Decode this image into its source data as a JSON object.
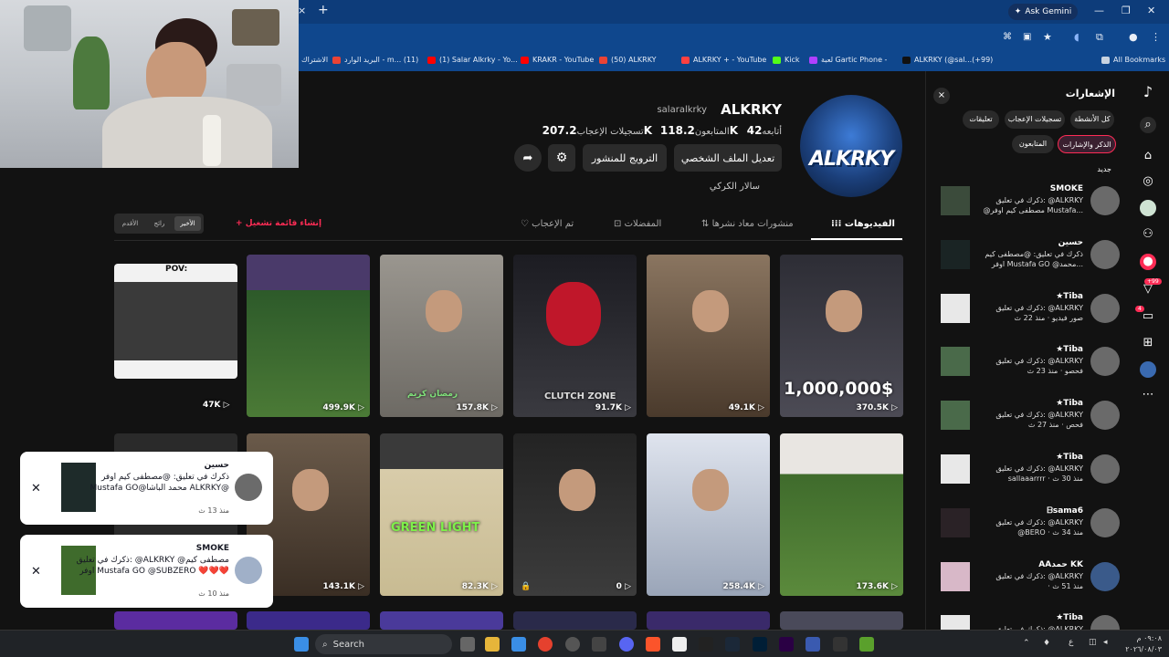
{
  "browser": {
    "gemini_label": "Ask Gemini",
    "new_tab": "+",
    "close_tab": "×",
    "bookmarks": [
      {
        "label": "الاشتراك",
        "color": "#cccccc"
      },
      {
        "label": "البريد الوارد - m... (11)",
        "color": "#ea4335"
      },
      {
        "label": "(1) Salar Alkrky - Yo...",
        "color": "#ff0000"
      },
      {
        "label": "KRAKR - YouTube",
        "color": "#ff0000"
      },
      {
        "label": "(50) ALKRKY",
        "color": "#ea4335"
      },
      {
        "label": "ALKRKY + - YouTube",
        "color": "#ff4040"
      },
      {
        "label": "Kick",
        "color": "#53fc18"
      },
      {
        "label": "لعبة Gartic Phone -",
        "color": "#b040ff"
      },
      {
        "label": "ALKRKY (@sal...(+99)",
        "color": "#111111"
      }
    ],
    "all_bookmarks": "All Bookmarks"
  },
  "profile": {
    "name": "ALKRKY",
    "handle": "salaralkrky",
    "avatar_text": "ALKRKY",
    "following_label": "أتابعه",
    "following_value": "42",
    "followers_label": "المتابعون",
    "followers_value": "118.2K",
    "likes_label": "تسجيلات الإعجاب",
    "likes_value": "207.2K",
    "edit_button": "تعديل الملف الشخصي",
    "promote_button": "الترويج للمنشور",
    "bio": "سالار الكركي"
  },
  "tabs": {
    "videos": "الفيديوهات",
    "reposts": "منشورات معاد نشرها",
    "favorites": "المفضلات",
    "liked": "تم الإعجاب"
  },
  "sort": {
    "latest": "الأخير",
    "popular": "رائج",
    "oldest": "الأقدم"
  },
  "playlist_label": "+ إنشاء قائمة تشغيل",
  "videos_row1": [
    {
      "views": "370.5K",
      "caption": "1,000,000$",
      "bg": "#3a3a44"
    },
    {
      "views": "49.1K",
      "caption": "",
      "bg": "#6a5240"
    },
    {
      "views": "91.7K",
      "caption": "CLUTCH ZONE",
      "bg": "#2c2b2f"
    },
    {
      "views": "157.8K",
      "caption": "رمضان كريم",
      "bg": "#7a7772"
    },
    {
      "views": "499.9K",
      "caption": "",
      "bg": "#2f5a2a"
    },
    {
      "views": "47K",
      "caption": "POV:",
      "bg": "#2c2c2c"
    }
  ],
  "videos_row2": [
    {
      "views": "173.6K",
      "caption": "",
      "bg": "#3f6b2c"
    },
    {
      "views": "258.4K",
      "caption": "",
      "bg": "#b9c4d6"
    },
    {
      "views": "0",
      "caption": "",
      "bg": "#2e2e2e"
    },
    {
      "views": "82.3K",
      "caption": "GREEN LIGHT",
      "bg": "#cfc3a0"
    },
    {
      "views": "143.1K",
      "caption": "",
      "bg": "#5a4a3a"
    },
    {
      "views": "",
      "caption": "",
      "bg": "#333"
    }
  ],
  "toasts": [
    {
      "name": "حسين",
      "text": "ذكرك في تعليق: @مصطفى كيم اوفر Mustafa GO@محمد الباشا ALKRKY@",
      "time": "منذ 13 ث"
    },
    {
      "name": "SMOKE",
      "text": "ذكرك في تعليق: @ALKRKY @مصطفى كيم اوفر Mustafa GO @SUBZERO ❤️❤️❤️",
      "time": "منذ 10 ث"
    }
  ],
  "notifications": {
    "title": "الإشعارات",
    "close": "×",
    "chips": [
      "كل الأنشطة",
      "تسجيلات الإعجاب",
      "تعليقات",
      "الذكر والإشارات",
      "المتابعون"
    ],
    "new_label": "جديد",
    "items": [
      {
        "name": "SMOKE",
        "line1": "ذكرك في تعليق: @ALKRKY",
        "line2": "@مصطفى كيم اوفر Mustafa..."
      },
      {
        "name": "حسين",
        "line1": "ذكرك في تعليق: @مصطفى كيم",
        "line2": "اوفر Mustafa GO @محمد..."
      },
      {
        "name": "★Tiba",
        "line1": "ذكرك في تعليق: @ALKRKY",
        "line2": "صور فيديو · منذ 22 ث"
      },
      {
        "name": "★Tiba",
        "line1": "ذكرك في تعليق: @ALKRKY",
        "line2": "فحصو · منذ 23 ث"
      },
      {
        "name": "★Tiba",
        "line1": "ذكرك في تعليق: @ALKRKY",
        "line2": "فحص · منذ 27 ث"
      },
      {
        "name": "★Tiba",
        "line1": "ذكرك في تعليق: @ALKRKY",
        "line2": "sallaaarrrr · منذ 30 ث"
      },
      {
        "name": "ᗷsama6",
        "line1": "ذكرك في تعليق: @ALKRKY",
        "line2": "@BERO · منذ 34 ث"
      },
      {
        "name": "AAحمد KK",
        "line1": "ذكرك في تعليق: @ALKRKY",
        "line2": "· منذ 51 ث"
      },
      {
        "name": "★Tiba",
        "line1": "ذكرك في تعليق: @ALKRKY",
        "line2": ""
      }
    ]
  },
  "rail": {
    "badge1": "+99",
    "badge2": "4"
  },
  "taskbar": {
    "search": "Search",
    "time": "٠٩:٠٨ م",
    "date": "٢٠٢٦/٠٨/٠٣",
    "lang": "ع"
  },
  "colors": {
    "accent": "#fe2c55",
    "chrome": "#0f478d",
    "bg": "#121212"
  }
}
